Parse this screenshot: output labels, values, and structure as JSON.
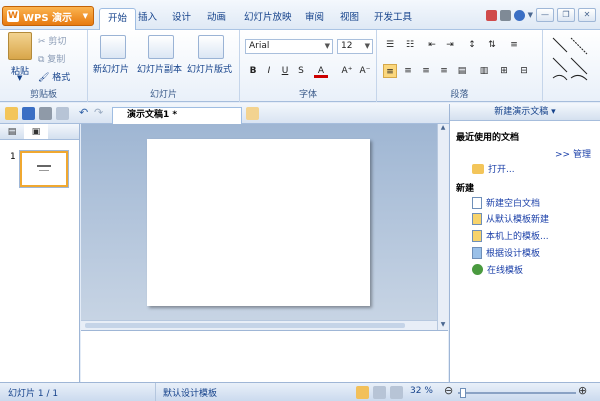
{
  "app": {
    "name": "WPS 演示"
  },
  "tabs": [
    "开始",
    "插入",
    "设计",
    "动画",
    "幻灯片放映",
    "审阅",
    "视图",
    "开发工具"
  ],
  "ribbon": {
    "clipboard": {
      "paste": "粘贴",
      "cut": "剪切",
      "copy": "复制",
      "format": "格式",
      "label": "剪贴板"
    },
    "slides": {
      "new": "新幻灯片",
      "copy": "幻灯片副本",
      "layout": "幻灯片版式",
      "label": "幻灯片"
    },
    "font": {
      "name": "Arial",
      "size": "12",
      "label": "字体",
      "bold": "B",
      "italic": "I",
      "underline": "U",
      "strike": "S",
      "color": "A",
      "grow": "A⁺",
      "shrink": "A⁻"
    },
    "paragraph": {
      "label": "段落"
    }
  },
  "document": {
    "tab": "演示文稿1 *"
  },
  "slide_panel": {
    "number": "1"
  },
  "taskpane": {
    "title": "新建演示文稿",
    "recent_label": "最近使用的文档",
    "manage": ">> 管理",
    "open": "打开...",
    "new_label": "新建",
    "items": [
      "新建空白文档",
      "从默认模板新建",
      "本机上的模板...",
      "根据设计模板",
      "在线模板"
    ]
  },
  "status": {
    "slide": "幻灯片 1 / 1",
    "template": "默认设计模板",
    "zoom": "32 %"
  },
  "colors": {
    "accent": "#e77a10",
    "ribbon": "#e9f0f9",
    "canvas": "#b3c4dc"
  }
}
